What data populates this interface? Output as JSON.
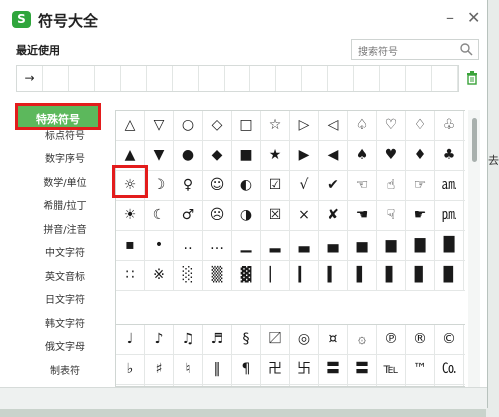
{
  "window": {
    "title": "符号大全",
    "logo": "S",
    "min_icon": "minimize-icon",
    "close_icon": "close-icon"
  },
  "recent": {
    "label": "最近使用",
    "symbols": [
      "→",
      "",
      "",
      "",
      "",
      "",
      "",
      "",
      "",
      "",
      "",
      "",
      "",
      "",
      "",
      "",
      ""
    ]
  },
  "search": {
    "placeholder": "搜索符号"
  },
  "sidebar": {
    "items": [
      "特殊符号",
      "标点符号",
      "数字序号",
      "数学/单位",
      "希腊/拉丁",
      "拼音/注音",
      "中文字符",
      "英文音标",
      "日文字符",
      "韩文字符",
      "俄文字母",
      "制表符"
    ],
    "active": "特殊符号"
  },
  "symbols": {
    "block1": [
      [
        "△",
        "▽",
        "○",
        "◇",
        "□",
        "☆",
        "▷",
        "◁",
        "♤",
        "♡",
        "♢",
        "♧"
      ],
      [
        "▲",
        "▼",
        "●",
        "◆",
        "■",
        "★",
        "▶",
        "◀",
        "♠",
        "♥",
        "♦",
        "♣"
      ],
      [
        "☼",
        "☽",
        "♀",
        "☺",
        "◐",
        "☑",
        "√",
        "✔",
        "☜",
        "☝",
        "☞",
        "㏂"
      ],
      [
        "☀",
        "☾",
        "♂",
        "☹",
        "◑",
        "☒",
        "×",
        "✘",
        "☚",
        "☟",
        "☛",
        "㏘"
      ],
      [
        "▪",
        "•",
        "‥",
        "…",
        "▁",
        "▂",
        "▃",
        "▄",
        "▅",
        "▆",
        "▇",
        "█"
      ],
      [
        "∷",
        "※",
        "░",
        "▒",
        "▓",
        "▏",
        "▎",
        "▍",
        "▌",
        "▋",
        "▊",
        "▉"
      ]
    ],
    "block2": [
      [
        "♩",
        "♪",
        "♫",
        "♬",
        "§",
        "〼",
        "◎",
        "¤",
        "۞",
        "℗",
        "®",
        "©"
      ],
      [
        "♭",
        "♯",
        "♮",
        "‖",
        "¶",
        "卍",
        "卐",
        "〓",
        "〓",
        "℡",
        "™",
        "㏇"
      ],
      [
        "",
        "",
        "",
        "",
        "",
        "",
        "",
        "",
        "",
        "",
        "",
        ""
      ]
    ]
  },
  "background": {
    "side_text": "去"
  },
  "colors": {
    "accent_green": "#5cb85c",
    "highlight_red": "#e31c1c"
  }
}
